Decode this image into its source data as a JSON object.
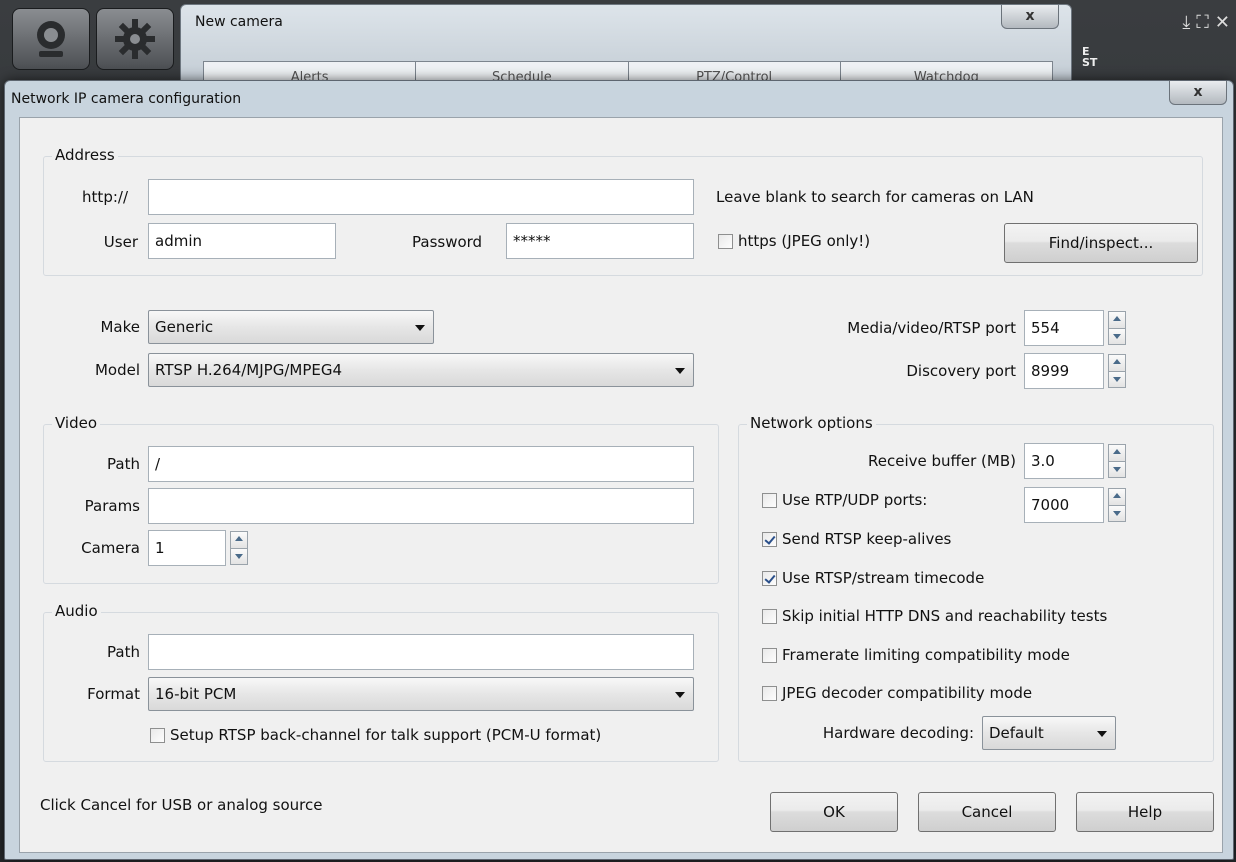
{
  "new_camera": {
    "title": "New camera",
    "close": "x",
    "tabs": [
      "Alerts",
      "Schedule",
      "PTZ/Control",
      "Watchdog"
    ]
  },
  "bg": {
    "est": "E ̇\nST"
  },
  "dialog": {
    "title": "Network IP camera configuration",
    "close": "x"
  },
  "address": {
    "legend": "Address",
    "http_label": "http://",
    "http_value": "",
    "hint": "Leave blank to search for cameras on LAN",
    "user_label": "User",
    "user_value": "admin",
    "password_label": "Password",
    "password_value": "*****",
    "https_label": "https (JPEG only!)",
    "https_checked": false,
    "find_button": "Find/inspect..."
  },
  "device": {
    "make_label": "Make",
    "make_value": "Generic",
    "model_label": "Model",
    "model_value": "RTSP H.264/MJPG/MPEG4",
    "rtsp_port_label": "Media/video/RTSP port",
    "rtsp_port_value": "554",
    "discovery_port_label": "Discovery port",
    "discovery_port_value": "8999"
  },
  "video": {
    "legend": "Video",
    "path_label": "Path",
    "path_value": "/",
    "params_label": "Params",
    "params_value": "",
    "camera_label": "Camera",
    "camera_value": "1"
  },
  "audio": {
    "legend": "Audio",
    "path_label": "Path",
    "path_value": "",
    "format_label": "Format",
    "format_value": "16-bit PCM",
    "backchannel_label": "Setup RTSP back-channel for talk support (PCM-U format)",
    "backchannel_checked": false
  },
  "network": {
    "legend": "Network options",
    "receive_buffer_label": "Receive buffer (MB)",
    "receive_buffer_value": "3.0",
    "rtp_udp_label": "Use RTP/UDP ports:",
    "rtp_udp_checked": false,
    "rtp_udp_value": "7000",
    "keepalive_label": "Send RTSP keep-alives",
    "keepalive_checked": true,
    "timecode_label": "Use RTSP/stream timecode",
    "timecode_checked": true,
    "skip_dns_label": "Skip initial HTTP DNS and reachability tests",
    "skip_dns_checked": false,
    "framerate_label": "Framerate limiting compatibility mode",
    "framerate_checked": false,
    "jpeg_label": "JPEG decoder compatibility mode",
    "jpeg_checked": false,
    "hw_label": "Hardware decoding:",
    "hw_value": "Default"
  },
  "footer": {
    "hint": "Click Cancel for USB or analog source",
    "ok": "OK",
    "cancel": "Cancel",
    "help": "Help"
  }
}
